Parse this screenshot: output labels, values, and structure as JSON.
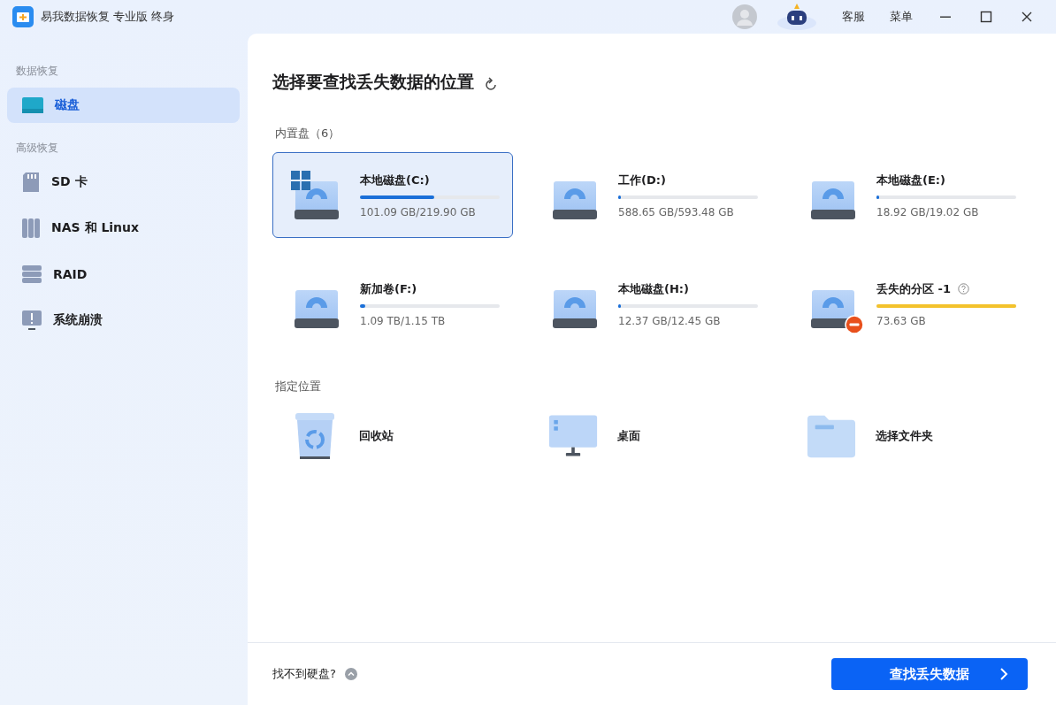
{
  "window": {
    "title": "易我数据恢复 专业版 终身",
    "actions": [
      "客服",
      "菜单"
    ]
  },
  "sidebar": {
    "sections": [
      {
        "heading": "数据恢复",
        "items": [
          {
            "label": "磁盘",
            "kind": "disk",
            "selected": true
          }
        ]
      },
      {
        "heading": "高级恢复",
        "items": [
          {
            "label": "SD 卡",
            "kind": "sd",
            "selected": false
          },
          {
            "label": "NAS 和 Linux",
            "kind": "nas",
            "selected": false
          },
          {
            "label": "RAID",
            "kind": "raid",
            "selected": false
          },
          {
            "label": "系统崩溃",
            "kind": "crash",
            "selected": false
          }
        ]
      }
    ]
  },
  "main": {
    "title": "选择要查找丢失数据的位置",
    "drives_heading": "内置盘（6）",
    "drives": [
      {
        "name": "本地磁盘(C:)",
        "usage": "101.09 GB/219.90 GB",
        "level": 0.53,
        "kind": "system",
        "selected": true
      },
      {
        "name": "工作(D:)",
        "usage": "588.65 GB/593.48 GB",
        "level": 0.02,
        "kind": "data",
        "selected": false
      },
      {
        "name": "本地磁盘(E:)",
        "usage": "18.92 GB/19.02 GB",
        "level": 0.02,
        "kind": "data",
        "selected": false
      },
      {
        "name": "新加卷(F:)",
        "usage": "1.09 TB/1.15 TB",
        "level": 0.04,
        "kind": "data",
        "selected": false
      },
      {
        "name": "本地磁盘(H:)",
        "usage": "12.37 GB/12.45 GB",
        "level": 0.02,
        "kind": "data",
        "selected": false
      },
      {
        "name": "丢失的分区 -1",
        "usage": "73.63 GB",
        "level": 1,
        "kind": "lost",
        "selected": false
      }
    ],
    "locations_heading": "指定位置",
    "locations": [
      {
        "label": "回收站",
        "kind": "recycle"
      },
      {
        "label": "桌面",
        "kind": "desktop"
      },
      {
        "label": "选择文件夹",
        "kind": "folder"
      }
    ]
  },
  "footer": {
    "help": "找不到硬盘?",
    "scan_button": "查找丢失数据"
  }
}
